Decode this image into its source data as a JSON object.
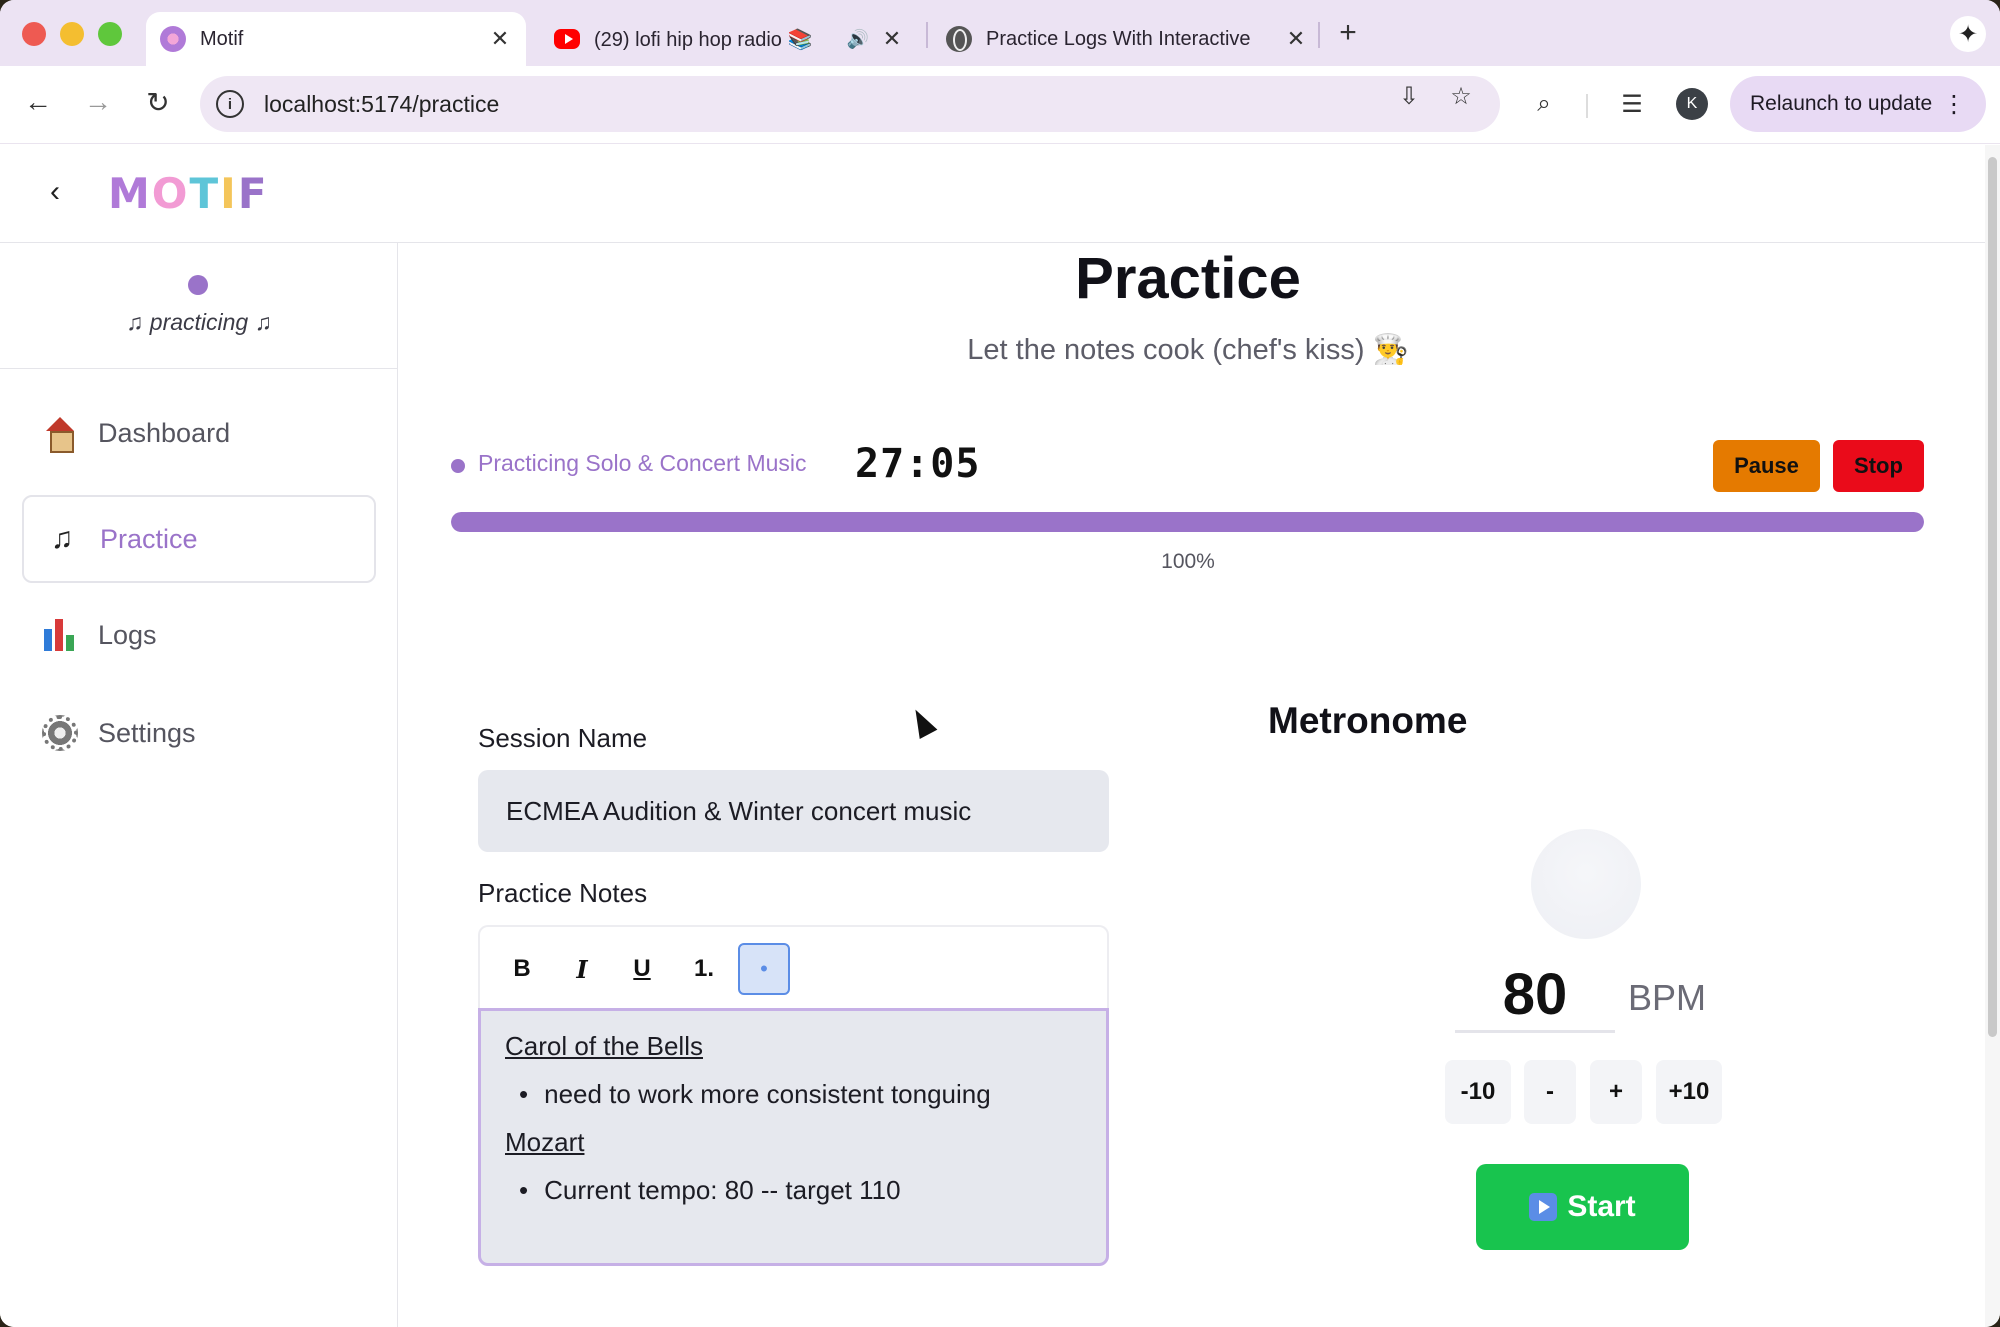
{
  "browser": {
    "tabs": [
      {
        "title": "Motif",
        "active": true,
        "icon": "motif-favicon"
      },
      {
        "title": "(29) lofi hip hop radio 📚",
        "active": false,
        "icon": "youtube-icon",
        "audio": "🔊"
      },
      {
        "title": "Practice Logs With Interactive",
        "active": false,
        "icon": "globe-icon"
      }
    ],
    "url": "localhost:5174/practice",
    "relaunch_label": "Relaunch to update",
    "profile_initial": "K"
  },
  "app": {
    "logo": [
      "M",
      "O",
      "T",
      "I",
      "F"
    ],
    "logo_colors": [
      "#b07ad8",
      "#f29bd4",
      "#5ec5d8",
      "#f4c55a",
      "#9a73c9"
    ],
    "status_text": "♫ practicing ♫",
    "nav": [
      {
        "label": "Dashboard",
        "icon": "house-icon",
        "active": false
      },
      {
        "label": "Practice",
        "icon": "music-note-icon",
        "active": true
      },
      {
        "label": "Logs",
        "icon": "bar-chart-icon",
        "active": false
      },
      {
        "label": "Settings",
        "icon": "gear-icon",
        "active": false
      }
    ]
  },
  "practice": {
    "title": "Practice",
    "subtitle": "Let the notes cook (chef's kiss) 👨‍🍳",
    "current_label": "Practicing Solo & Concert Music",
    "timer": "27:05",
    "pause_label": "Pause",
    "stop_label": "Stop",
    "progress_percent": 100,
    "progress_text": "100%",
    "session_label": "Session Name",
    "session_value": "ECMEA Audition & Winter concert music",
    "notes_label": "Practice Notes",
    "toolbar": {
      "bold": "B",
      "italic": "I",
      "underline": "U",
      "ordered": "1.",
      "bullet": "•"
    },
    "notes": [
      {
        "heading": "Carol of the Bells",
        "bullets": [
          "need to work more consistent tonguing"
        ]
      },
      {
        "heading": "Mozart",
        "bullets": [
          "Current tempo: 80 -- target 110"
        ]
      }
    ]
  },
  "metronome": {
    "title": "Metronome",
    "bpm": "80",
    "unit": "BPM",
    "buttons": [
      "-10",
      "-",
      "+",
      "+10"
    ],
    "start_label": "Start"
  },
  "colors": {
    "accent": "#9a73c9",
    "pause": "#e57a00",
    "stop": "#ea0b1a",
    "start": "#18c44e"
  }
}
